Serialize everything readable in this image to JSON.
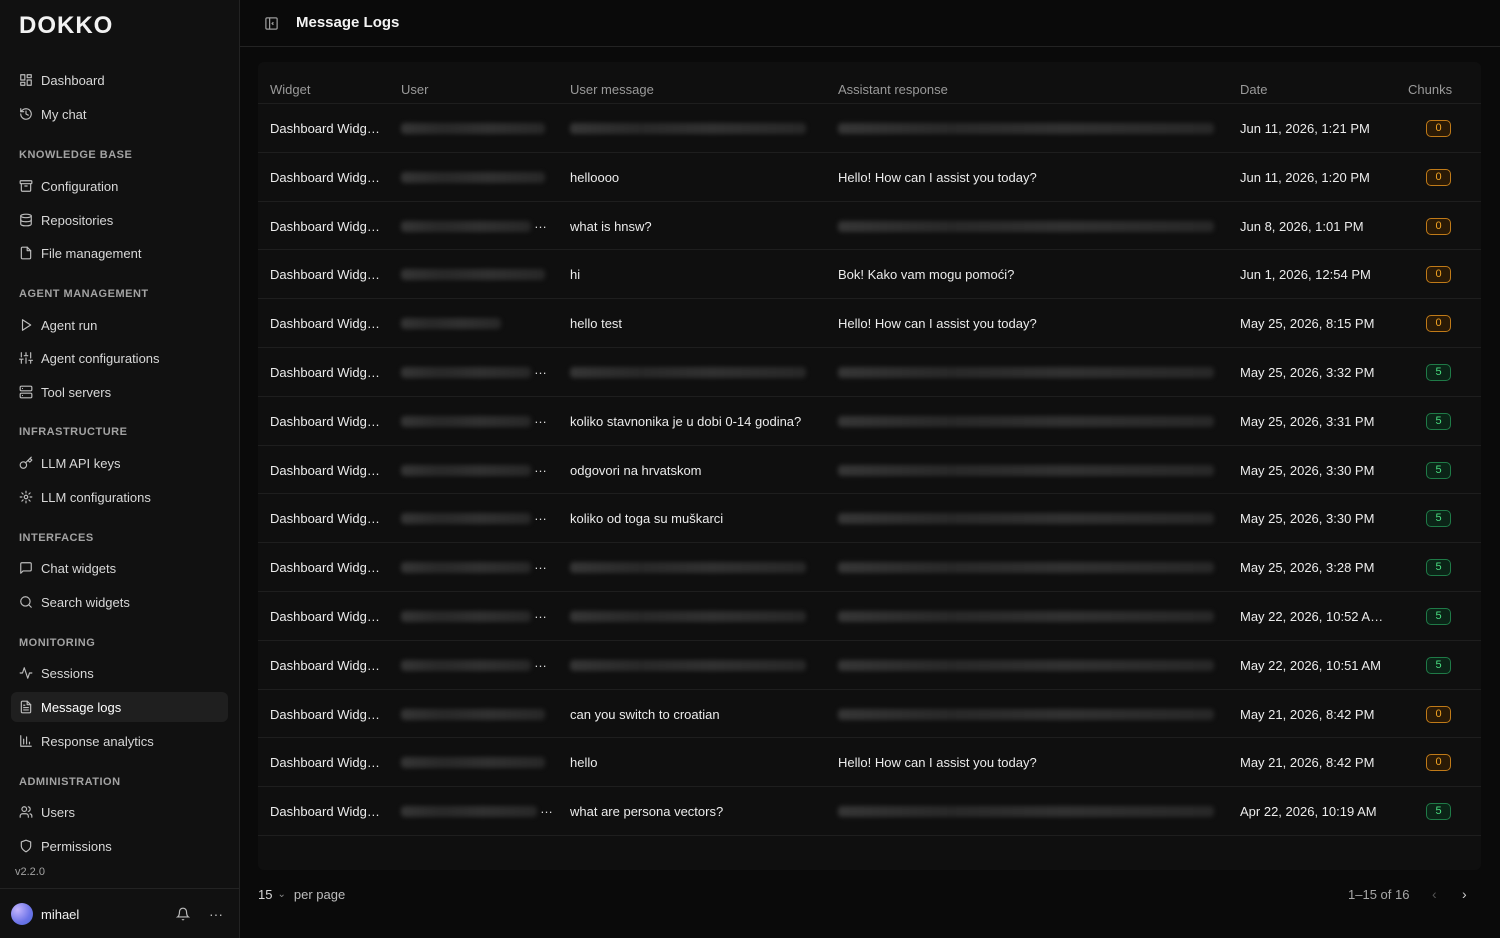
{
  "brand": {
    "logo": "DOKKO",
    "version": "v2.2.0"
  },
  "sidebar": {
    "top_items": [
      {
        "label": "Dashboard",
        "icon": "grid-icon"
      },
      {
        "label": "My chat",
        "icon": "history-icon"
      }
    ],
    "sections": [
      {
        "title": "KNOWLEDGE BASE",
        "items": [
          {
            "label": "Configuration",
            "icon": "archive-icon"
          },
          {
            "label": "Repositories",
            "icon": "database-icon"
          },
          {
            "label": "File management",
            "icon": "file-icon"
          }
        ]
      },
      {
        "title": "AGENT MANAGEMENT",
        "items": [
          {
            "label": "Agent run",
            "icon": "play-icon"
          },
          {
            "label": "Agent configurations",
            "icon": "sliders-icon"
          },
          {
            "label": "Tool servers",
            "icon": "server-icon"
          }
        ]
      },
      {
        "title": "INFRASTRUCTURE",
        "items": [
          {
            "label": "LLM API keys",
            "icon": "key-icon"
          },
          {
            "label": "LLM configurations",
            "icon": "gear-icon"
          }
        ]
      },
      {
        "title": "INTERFACES",
        "items": [
          {
            "label": "Chat widgets",
            "icon": "message-icon"
          },
          {
            "label": "Search widgets",
            "icon": "search-icon"
          }
        ]
      },
      {
        "title": "MONITORING",
        "items": [
          {
            "label": "Sessions",
            "icon": "activity-icon"
          },
          {
            "label": "Message logs",
            "icon": "file-text-icon",
            "active": true
          },
          {
            "label": "Response analytics",
            "icon": "bar-chart-icon"
          }
        ]
      },
      {
        "title": "ADMINISTRATION",
        "items": [
          {
            "label": "Users",
            "icon": "users-icon"
          },
          {
            "label": "Permissions",
            "icon": "shield-icon"
          }
        ]
      }
    ]
  },
  "user": {
    "name": "mihael"
  },
  "header": {
    "title": "Message Logs"
  },
  "table": {
    "columns": [
      "Widget",
      "User",
      "User message",
      "Assistant response",
      "Date",
      "Chunks"
    ],
    "rows": [
      {
        "widget": "Dashboard Widg…",
        "user_ellipsis": false,
        "user_msg": "",
        "assistant": "",
        "date": "Jun 11, 2026, 1:21 PM",
        "chunks": "0"
      },
      {
        "widget": "Dashboard Widg…",
        "user_ellipsis": false,
        "user_msg": "helloooo",
        "assistant": "Hello! How can I assist you today?",
        "date": "Jun 11, 2026, 1:20 PM",
        "chunks": "0"
      },
      {
        "widget": "Dashboard Widg…",
        "user_ellipsis": true,
        "user_msg": "what is hnsw?",
        "assistant": "",
        "date": "Jun 8, 2026, 1:01 PM",
        "chunks": "0"
      },
      {
        "widget": "Dashboard Widg…",
        "user_ellipsis": false,
        "user_msg": "hi",
        "assistant": "Bok! Kako vam mogu pomoći?",
        "date": "Jun 1, 2026, 12:54 PM",
        "chunks": "0"
      },
      {
        "widget": "Dashboard Widg…",
        "user_ellipsis": false,
        "user_msg": "hello test",
        "assistant": "Hello! How can I assist you today?",
        "date": "May 25, 2026, 8:15 PM",
        "chunks": "0"
      },
      {
        "widget": "Dashboard Widg…",
        "user_ellipsis": true,
        "user_msg": "",
        "assistant": "",
        "date": "May 25, 2026, 3:32 PM",
        "chunks": "5"
      },
      {
        "widget": "Dashboard Widg…",
        "user_ellipsis": true,
        "user_msg": "koliko stavnonika je u dobi 0-14 godina?",
        "assistant": "",
        "date": "May 25, 2026, 3:31 PM",
        "chunks": "5"
      },
      {
        "widget": "Dashboard Widg…",
        "user_ellipsis": true,
        "user_msg": "odgovori na hrvatskom",
        "assistant": "",
        "date": "May 25, 2026, 3:30 PM",
        "chunks": "5"
      },
      {
        "widget": "Dashboard Widg…",
        "user_ellipsis": true,
        "user_msg": "koliko od toga su muškarci",
        "assistant": "",
        "date": "May 25, 2026, 3:30 PM",
        "chunks": "5"
      },
      {
        "widget": "Dashboard Widg…",
        "user_ellipsis": true,
        "user_msg": "",
        "assistant": "",
        "date": "May 25, 2026, 3:28 PM",
        "chunks": "5"
      },
      {
        "widget": "Dashboard Widg…",
        "user_ellipsis": true,
        "user_msg": "",
        "assistant": "",
        "date": "May 22, 2026, 10:52 A…",
        "chunks": "5"
      },
      {
        "widget": "Dashboard Widg…",
        "user_ellipsis": true,
        "user_msg": "",
        "assistant": "",
        "date": "May 22, 2026, 10:51 AM",
        "chunks": "5"
      },
      {
        "widget": "Dashboard Widg…",
        "user_ellipsis": false,
        "user_msg": "can you switch to croatian",
        "assistant": "",
        "date": "May 21, 2026, 8:42 PM",
        "chunks": "0"
      },
      {
        "widget": "Dashboard Widg…",
        "user_ellipsis": false,
        "user_msg": "hello",
        "assistant": "Hello! How can I assist you today?",
        "date": "May 21, 2026, 8:42 PM",
        "chunks": "0"
      },
      {
        "widget": "Dashboard Widg…",
        "user_ellipsis": true,
        "user_msg": "what are persona vectors?",
        "assistant": "",
        "date": "Apr 22, 2026, 10:19 AM",
        "chunks": "5"
      }
    ]
  },
  "pagination": {
    "per_page_value": "15",
    "per_page_label": "per page",
    "range": "1–15 of 16"
  },
  "colors": {
    "zero_badge": "#f5a524",
    "five_badge": "#4ade80",
    "background": "#0a0a0a"
  }
}
